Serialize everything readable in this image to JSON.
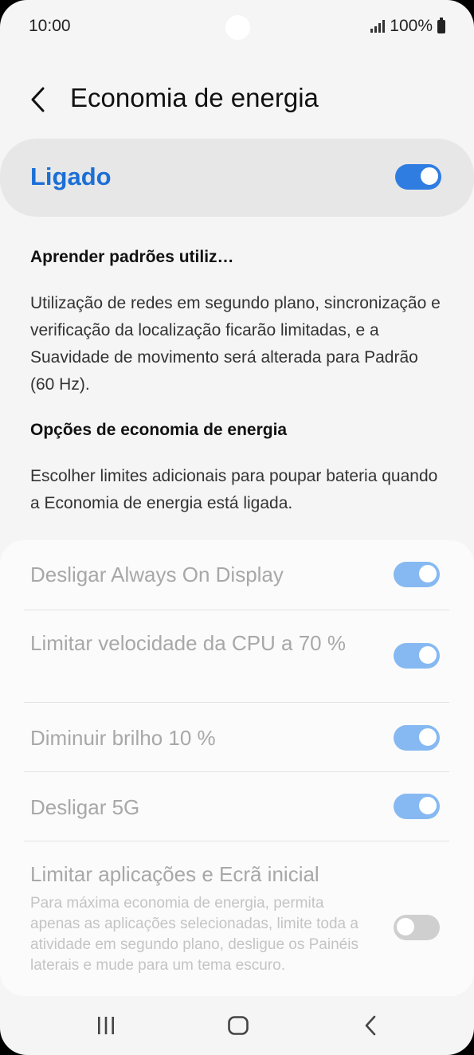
{
  "status_bar": {
    "time": "10:00",
    "battery": "100%"
  },
  "header": {
    "title": "Economia de energia",
    "back_icon": "chevron-left-icon"
  },
  "master_toggle": {
    "label": "Ligado",
    "state": "on"
  },
  "learn_patterns": {
    "title": "Aprender padrões utiliz…"
  },
  "description": "Utilização de redes em segundo plano, sincronização e verificação da localização ficarão limitadas, e a Suavidade de movimento será alterada para Padrão (60 Hz).",
  "options_section": {
    "title": "Opções de economia de energia",
    "description": "Escolher limites adicionais para poupar bateria quando a Economia de energia está ligada."
  },
  "options": [
    {
      "label": "Desligar Always On Display",
      "state": "on"
    },
    {
      "label": "Limitar velocidade da CPU a 70 %",
      "state": "on"
    },
    {
      "label": "Diminuir brilho 10 %",
      "state": "on"
    },
    {
      "label": "Desligar 5G",
      "state": "on"
    },
    {
      "label": "Limitar aplicações e Ecrã inicial",
      "sublabel": "Para máxima economia de energia, permita apenas as aplicações selecionadas, limite toda a atividade em segundo plano, desligue os Painéis laterais e mude para um tema escuro.",
      "state": "off"
    }
  ],
  "nav_bar": {
    "recents_icon": "recents-icon",
    "home_icon": "home-icon",
    "back_icon": "back-icon"
  },
  "colors": {
    "accent": "#2f7de1",
    "accent_dim": "#86b9f2",
    "label_blue": "#1b6fd6"
  }
}
